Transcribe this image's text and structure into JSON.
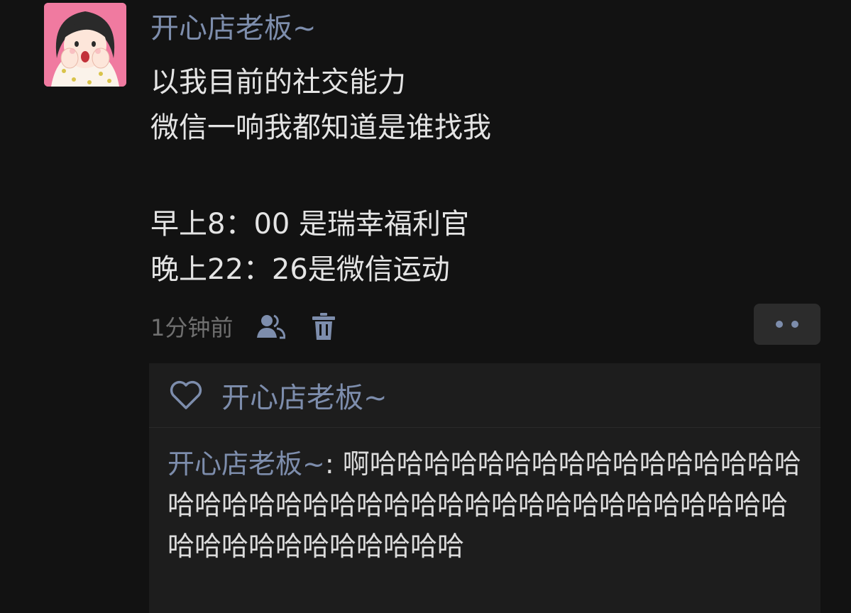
{
  "post": {
    "author": "开心店老板~",
    "avatar_icon": "girl-avatar",
    "lines": [
      "以我目前的社交能力",
      "微信一响我都知道是谁找我",
      "",
      "早上8：00 是瑞幸福利官",
      "晚上22：26是微信运动"
    ],
    "time": "1分钟前",
    "visibility_icon": "friends-icon",
    "delete_icon": "trash-icon",
    "more_icon": "more-dots-icon"
  },
  "likes": {
    "icon": "heart-icon",
    "users": [
      "开心店老板~"
    ]
  },
  "comments": [
    {
      "author": "开心店老板~",
      "separator": ": ",
      "text": "啊哈哈哈哈哈哈哈哈哈哈哈哈哈哈哈哈哈哈哈哈哈哈哈哈哈哈哈哈哈哈哈哈哈哈哈哈哈哈哈哈哈哈哈哈哈哈哈哈哈哈"
    }
  ],
  "colors": {
    "background": "#121212",
    "name_link": "#7d8dac",
    "body_text": "#e4e4e4",
    "meta_text": "#6f6f6f",
    "panel": "#1d1d1d"
  }
}
